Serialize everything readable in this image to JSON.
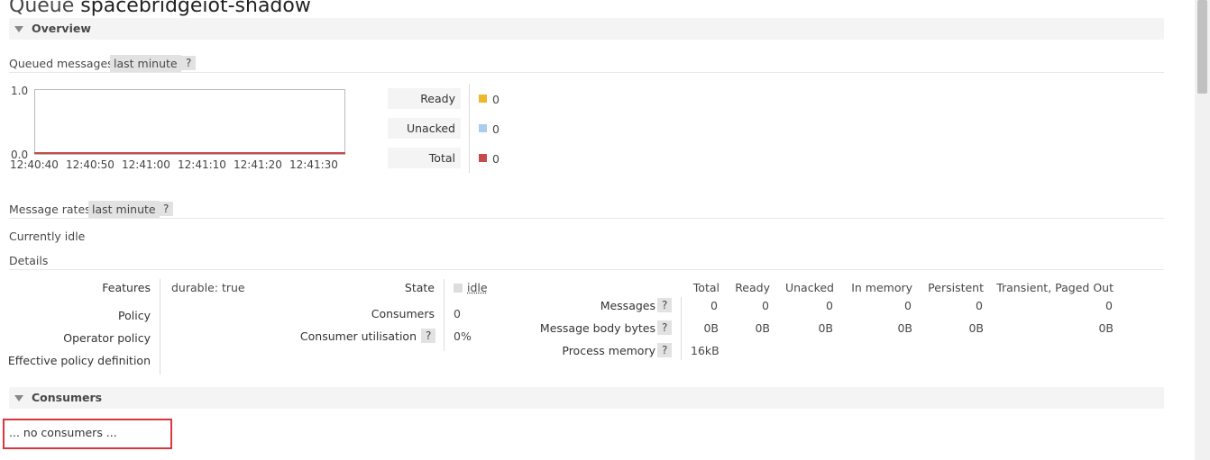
{
  "page": {
    "title_prefix": "Queue",
    "queue_name": "spacebridgeiot-shadow"
  },
  "overview": {
    "header": "Overview",
    "queued_messages_label": "Queued messages",
    "range_pill": "last minute",
    "help": "?",
    "chart": {
      "y_top": "1.0",
      "y_bottom": "0.0",
      "x_ticks": [
        "12:40:40",
        "12:40:50",
        "12:41:00",
        "12:41:10",
        "12:41:20",
        "12:41:30"
      ]
    },
    "legend": [
      {
        "label": "Ready",
        "value": "0",
        "color": "#edb72e"
      },
      {
        "label": "Unacked",
        "value": "0",
        "color": "#a8cdee"
      },
      {
        "label": "Total",
        "value": "0",
        "color": "#c84b4b"
      }
    ],
    "message_rates_label": "Message rates",
    "rates_range_pill": "last minute",
    "currently_idle": "Currently idle",
    "details_label": "Details"
  },
  "details": {
    "features_label": "Features",
    "features_key": "durable:",
    "features_value": "true",
    "policy_label": "Policy",
    "operator_policy_label": "Operator policy",
    "effective_policy_label": "Effective policy definition",
    "state_label": "State",
    "state_value": "idle",
    "consumers_label": "Consumers",
    "consumers_value": "0",
    "consumer_utilisation_label": "Consumer utilisation",
    "consumer_utilisation_value": "0%",
    "stats_columns": [
      "Total",
      "Ready",
      "Unacked",
      "In memory",
      "Persistent",
      "Transient, Paged Out"
    ],
    "messages_label": "Messages",
    "messages_values": [
      "0",
      "0",
      "0",
      "0",
      "0",
      "0"
    ],
    "body_bytes_label": "Message body bytes",
    "body_bytes_values": [
      "0B",
      "0B",
      "0B",
      "0B",
      "0B",
      "0B"
    ],
    "process_memory_label": "Process memory",
    "process_memory_value": "16kB"
  },
  "consumers": {
    "header": "Consumers",
    "empty_text": "... no consumers ..."
  }
}
